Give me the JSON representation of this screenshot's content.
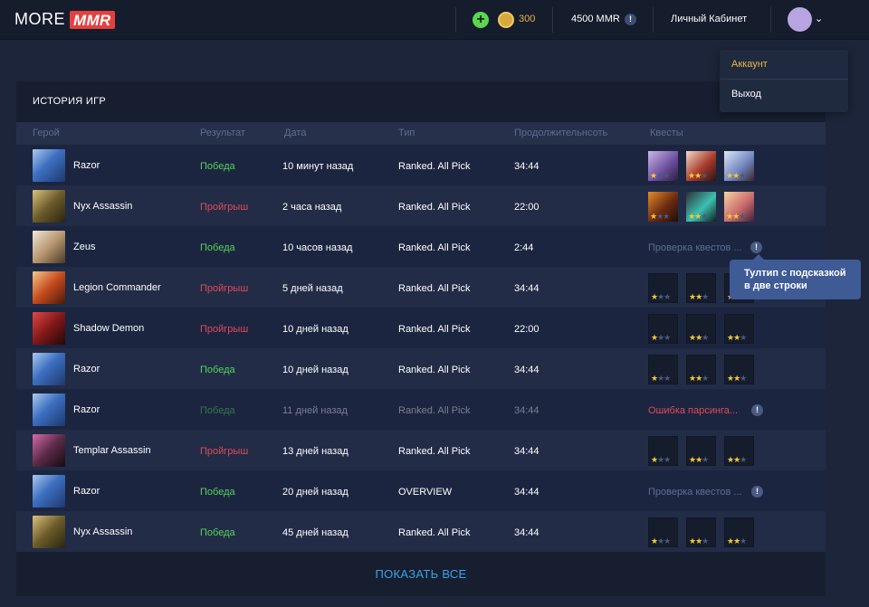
{
  "header": {
    "logo_text": "MORE",
    "logo_badge": "MMR",
    "coins": "300",
    "mmr": "4500 MMR",
    "cabinet_label": "Личный Кабинет"
  },
  "dropdown": {
    "account_label": "Аккаунт",
    "exit_label": "Выход"
  },
  "history": {
    "title": "ИСТОРИЯ ИГР",
    "columns": [
      "Герой",
      "Результат",
      "Дата",
      "Тип",
      "Продолжительнсоть",
      "Квесты"
    ],
    "rows": [
      {
        "hero": "Razor",
        "result": "Победа",
        "date": "10 минут назад",
        "type": "Ranked. All Pick",
        "duration": "34:44"
      },
      {
        "hero": "Nyx Assassin",
        "result": "Пройгрыш",
        "date": "2 часа назад",
        "type": "Ranked. All Pick",
        "duration": "22:00"
      },
      {
        "hero": "Zeus",
        "result": "Победа",
        "date": "10 часов назад",
        "type": "Ranked. All Pick",
        "duration": "2:44",
        "quest_note": "Проверка квестов ..."
      },
      {
        "hero": "Legion Commander",
        "result": "Пройгрыш",
        "date": "5 дней назад",
        "type": "Ranked. All Pick",
        "duration": "34:44"
      },
      {
        "hero": "Shadow Demon",
        "result": "Пройгрыш",
        "date": "10 дней назад",
        "type": "Ranked. All Pick",
        "duration": "22:00"
      },
      {
        "hero": "Razor",
        "result": "Победа",
        "date": "10 дней назад",
        "type": "Ranked. All Pick",
        "duration": "34:44"
      },
      {
        "hero": "Razor",
        "result": "Победа",
        "date": "11 дней назад",
        "type": "Ranked. All Pick",
        "duration": "34:44",
        "quest_note": "Ошибка парсинга..."
      },
      {
        "hero": "Templar Assassin",
        "result": "Пройгрыш",
        "date": "13 дней назад",
        "type": "Ranked. All Pick",
        "duration": "34:44"
      },
      {
        "hero": "Razor",
        "result": "Победа",
        "date": "20 дней назад",
        "type": "OVERVIEW",
        "duration": "34:44",
        "quest_note": "Проверка квестов ..."
      },
      {
        "hero": "Nyx Assassin",
        "result": "Победа",
        "date": "45 дней назад",
        "type": "Ranked. All Pick",
        "duration": "34:44"
      }
    ],
    "show_all": "ПОКАЗАТЬ ВСЕ"
  },
  "tooltip": {
    "line1": "Тултип с подсказкой",
    "line2": "в две строки"
  },
  "colors": {
    "win": "#54d35a",
    "loss": "#e04a58",
    "accent": "#3aa3e8",
    "gold": "#e9b848"
  },
  "icons": [
    "plus-icon",
    "coin-icon",
    "info-icon",
    "chevron-down-icon",
    "star-icon"
  ]
}
